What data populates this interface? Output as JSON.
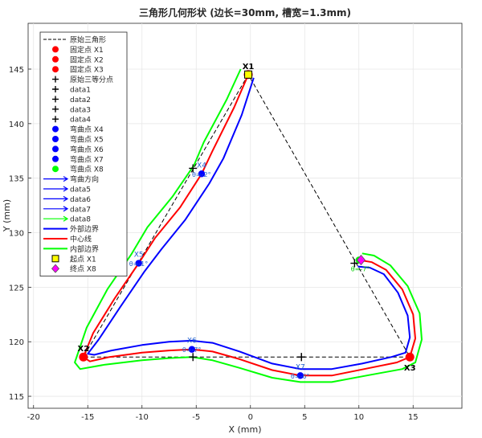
{
  "chart_data": {
    "type": "line",
    "title": "三角形几何形状 (边长=30mm, 槽宽=1.3mm)",
    "xlabel": "X (mm)",
    "ylabel": "Y (mm)",
    "xlim": [
      -20.5,
      19.5
    ],
    "ylim": [
      113.9,
      149.2
    ],
    "xticks": [
      -20,
      -15,
      -10,
      -5,
      0,
      5,
      10,
      15
    ],
    "yticks": [
      115,
      120,
      125,
      130,
      135,
      140,
      145
    ],
    "xtick_labels": [
      "-20",
      "-15",
      "-10",
      "-5",
      "0",
      "5",
      "10",
      "15"
    ],
    "ytick_labels": [
      "115",
      "120",
      "125",
      "130",
      "135",
      "140",
      "145"
    ],
    "grid": true,
    "legend_position": "top-left",
    "colors": {
      "original": "#000000",
      "fixed": "#ff0000",
      "bend": "#0000ff",
      "outer": "#0000ff",
      "center": "#ff0000",
      "inner": "#00ff00",
      "start": "#ffff00",
      "end": "#ff00ff",
      "label_blue": "#1f5fd0"
    },
    "original_triangle": {
      "name": "原始三角形",
      "x": [
        -0.2,
        -15.4,
        14.7,
        -0.2
      ],
      "y": [
        144.5,
        118.6,
        118.6,
        144.5
      ]
    },
    "fixed_points": [
      {
        "legend": "固定点 X1",
        "label": "X1",
        "x": -0.2,
        "y": 144.5
      },
      {
        "legend": "固定点 X2",
        "label": "X2",
        "x": -15.4,
        "y": 118.6
      },
      {
        "legend": "固定点 X3",
        "label": "X3",
        "x": 14.7,
        "y": 118.6
      }
    ],
    "trisection_points": [
      {
        "legend": "原始三等分点",
        "x": -5.3,
        "y": 118.6
      },
      {
        "legend": "data1",
        "x": 4.7,
        "y": 118.6
      },
      {
        "legend": "data2",
        "x": -5.3,
        "y": 135.9
      },
      {
        "legend": "data3",
        "x": 9.6,
        "y": 127.2
      },
      {
        "legend": "data4",
        "x": 4.7,
        "y": 118.6
      }
    ],
    "bend_points": [
      {
        "legend": "弯曲点 X4",
        "label": "X4",
        "angle_label": "θ=-2°",
        "x": -4.5,
        "y": 135.4
      },
      {
        "legend": "弯曲点 X5",
        "label": "X5",
        "angle_label": "θ=-1°",
        "x": -10.3,
        "y": 127.2
      },
      {
        "legend": "弯曲点 X6",
        "label": "X6",
        "angle_label": "θ=-7°",
        "x": -5.4,
        "y": 119.3
      },
      {
        "legend": "弯曲点 X7",
        "label": "X7",
        "angle_label": "θ=-6°",
        "x": 4.6,
        "y": 116.9
      }
    ],
    "end_bend_point": {
      "legend": "弯曲点 X8",
      "label": "θ=-7°",
      "x": 10.0,
      "y": 127.5
    },
    "bend_direction_legends": [
      "弯曲方向",
      "data5",
      "data6",
      "data7",
      "data8"
    ],
    "centerline": {
      "name": "中心线",
      "x": [
        -0.2,
        -1.5,
        -3.5,
        -4.5,
        -6.5,
        -8.8,
        -10.3,
        -12.5,
        -14.5,
        -15.4,
        -14.8,
        -13.0,
        -10.0,
        -7.5,
        -5.4,
        -3.5,
        -1.0,
        2.0,
        4.6,
        7.5,
        10.5,
        13.5,
        14.7,
        15.2,
        15.0,
        14.0,
        12.5,
        11.2,
        10.0
      ],
      "y": [
        144.5,
        141.5,
        137.5,
        135.4,
        132.3,
        129.5,
        127.2,
        124.0,
        120.8,
        118.6,
        118.2,
        118.6,
        119.0,
        119.2,
        119.3,
        119.1,
        118.4,
        117.4,
        116.9,
        116.9,
        117.5,
        118.1,
        118.6,
        120.3,
        122.5,
        124.8,
        126.6,
        127.3,
        127.5
      ]
    },
    "outer_boundary": {
      "name": "外部边界",
      "x": [
        0.3,
        -0.8,
        -2.5,
        -3.8,
        -6.0,
        -8.2,
        -9.8,
        -12.0,
        -14.0,
        -15.0,
        -14.4,
        -12.8,
        -10.0,
        -7.5,
        -5.4,
        -3.5,
        -1.0,
        2.0,
        4.6,
        7.5,
        10.3,
        13.0,
        14.3,
        14.7,
        14.5,
        13.6,
        12.3,
        11.0,
        9.9
      ],
      "y": [
        144.2,
        140.8,
        136.8,
        134.5,
        131.2,
        128.5,
        126.4,
        123.2,
        120.2,
        118.9,
        118.8,
        119.2,
        119.7,
        120.0,
        120.1,
        119.9,
        119.1,
        118.0,
        117.5,
        117.5,
        118.0,
        118.6,
        119.0,
        120.4,
        122.4,
        124.5,
        126.2,
        126.8,
        126.9
      ]
    },
    "inner_boundary": {
      "name": "内部边界",
      "x": [
        -0.9,
        -2.2,
        -4.3,
        -5.2,
        -7.2,
        -9.5,
        -11.0,
        -13.2,
        -15.1,
        -16.2,
        -15.7,
        -13.4,
        -10.0,
        -7.5,
        -5.4,
        -3.5,
        -1.0,
        2.0,
        4.6,
        7.5,
        10.7,
        14.0,
        15.2,
        15.8,
        15.6,
        14.5,
        12.9,
        11.4,
        10.3
      ],
      "y": [
        145.0,
        142.2,
        138.3,
        136.2,
        133.3,
        130.5,
        128.0,
        124.8,
        121.3,
        118.1,
        117.5,
        117.9,
        118.3,
        118.5,
        118.6,
        118.3,
        117.6,
        116.7,
        116.3,
        116.3,
        116.9,
        117.5,
        118.1,
        120.2,
        122.6,
        125.1,
        127.0,
        127.9,
        128.1
      ]
    },
    "start_marker": {
      "legend": "起点 X1",
      "x": -0.2,
      "y": 144.5
    },
    "end_marker": {
      "legend": "终点 X8",
      "x": 10.2,
      "y": 127.5
    }
  }
}
